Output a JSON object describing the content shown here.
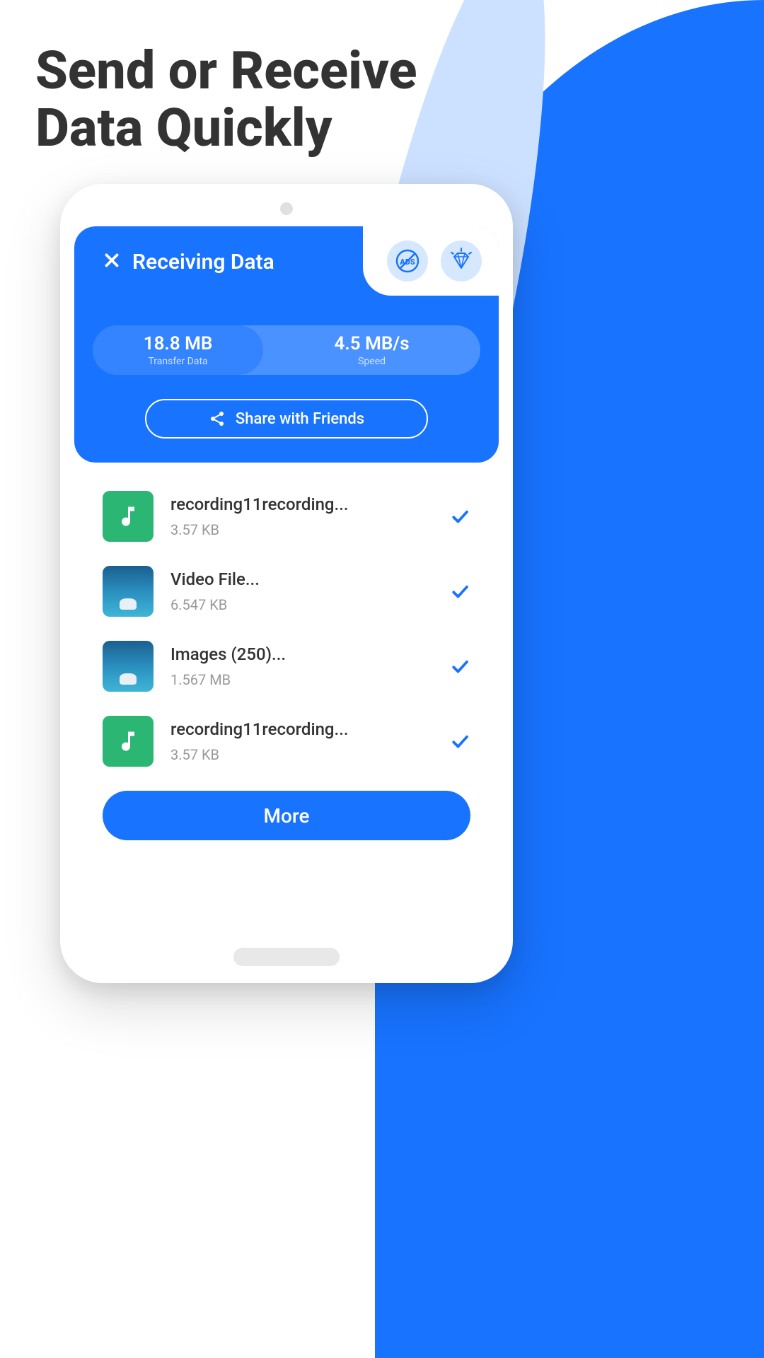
{
  "headline": {
    "line1": "Send or Receive",
    "line2": "Data Quickly"
  },
  "header": {
    "title": "Receiving Data",
    "badges": {
      "no_ads": "ADS",
      "premium": "diamond"
    }
  },
  "stats": {
    "transfer_value": "18.8 MB",
    "transfer_label": "Transfer Data",
    "speed_value": "4.5 MB/s",
    "speed_label": "Speed"
  },
  "share_button": "Share with Friends",
  "files": [
    {
      "name": "recording11recording...",
      "size": "3.57 KB",
      "type": "audio"
    },
    {
      "name": "Video File...",
      "size": "6.547 KB",
      "type": "image"
    },
    {
      "name": "Images (250)...",
      "size": "1.567 MB",
      "type": "image"
    },
    {
      "name": "recording11recording...",
      "size": "3.57 KB",
      "type": "audio"
    }
  ],
  "more_button": "More",
  "colors": {
    "primary": "#1873ff",
    "accent": "#2bb673"
  }
}
